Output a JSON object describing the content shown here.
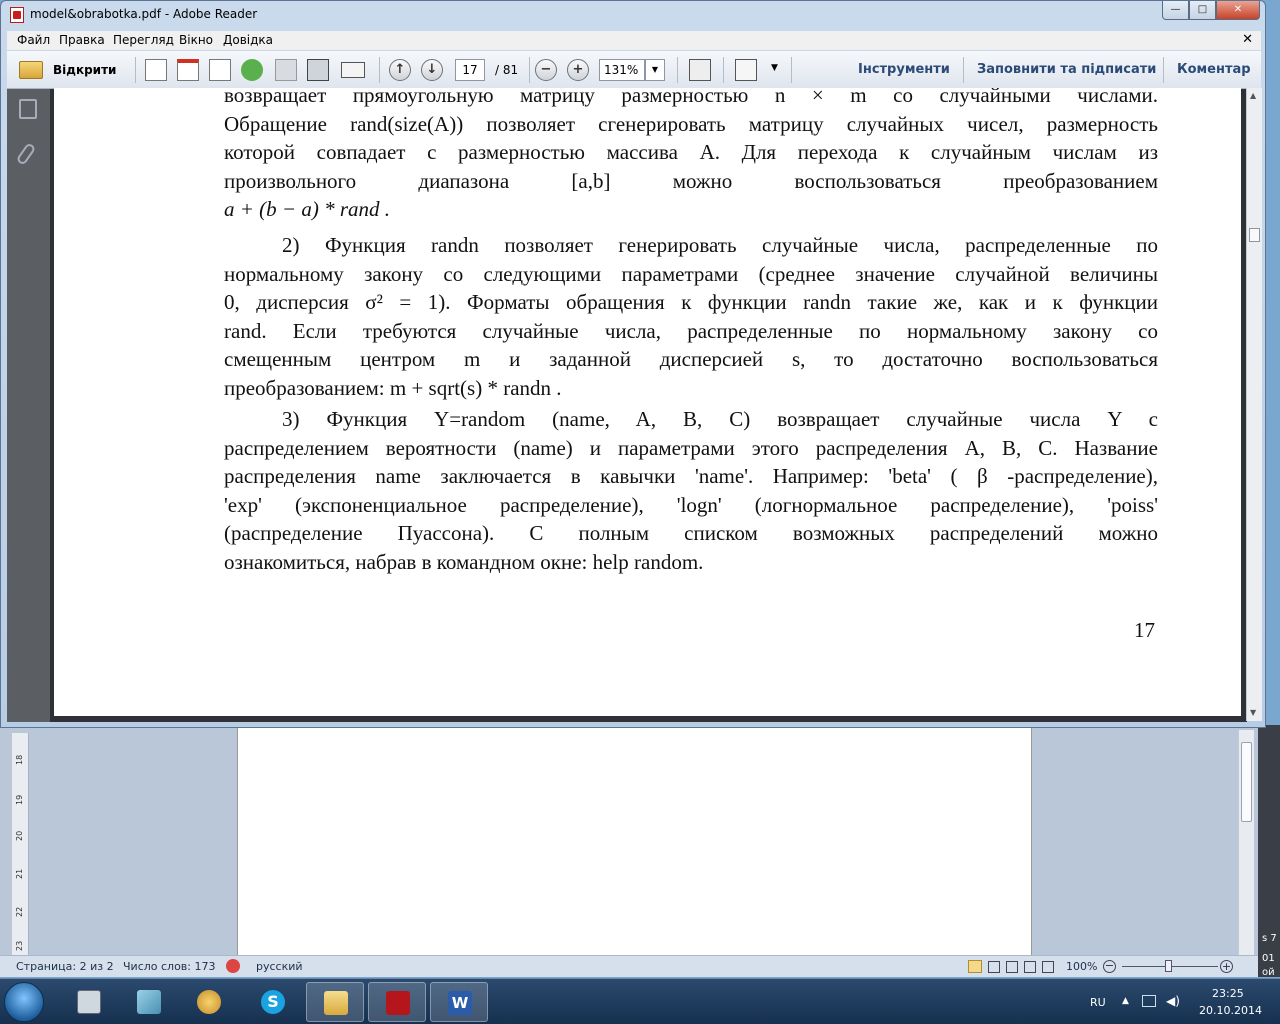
{
  "window": {
    "title": "model&obrabotka.pdf - Adobe Reader",
    "buttons": {
      "minimize": "—",
      "maximize": "□",
      "close": "✕"
    }
  },
  "menu": [
    "Файл",
    "Правка",
    "Перегляд",
    "Вікно",
    "Довідка"
  ],
  "toolbar": {
    "open_label": "Відкрити",
    "page_current": "17",
    "page_total": "/ 81",
    "zoom": "131%",
    "tools_label": "Інструменти",
    "fill_sign_label": "Заповнити та підписати",
    "comment_label": "Коментар"
  },
  "document": {
    "para1": [
      "возвращает прямоугольную матрицу размерностью  n × m  со случайными числами.",
      "Обращение rand(size(A)) позволяет сгенерировать матрицу случайных чисел, размерность",
      "которой совпадает с размерностью массива А. Для перехода к случайным числам из",
      "произвольного диапазона [a,b] можно воспользоваться преобразованием",
      "a + (b − a) * rand ."
    ],
    "para2": [
      "2) Функция randn позволяет генерировать случайные числа, распределенные по",
      "нормальному закону со следующими параметрами (среднее значение случайной величины",
      "0, дисперсия  σ² = 1). Форматы обращения к функции randn такие же, как и к функции",
      "rand. Если требуются случайные числа, распределенные по нормальному закону со",
      "смещенным центром m и заданной дисперсией s, то достаточно воспользоваться",
      "преобразованием:  m + sqrt(s) * randn ."
    ],
    "para3": [
      "3) Функция Y=random (name, A, B, C) возвращает случайные числа Y с",
      "распределением вероятности (name) и параметрами этого распределения A, B, C. Название",
      "распределения name заключается в кавычки 'name'. Например: 'beta' ( β -распределение),",
      "'exp' (экспоненциальное распределение), 'logn' (логнормальное распределение), 'poiss'",
      "(распределение Пуассона). С полным списком возможных распределений можно",
      "ознакомиться, набрав в командном окне: help random."
    ],
    "page_number": "17"
  },
  "word_status": {
    "page": "Страница: 2 из 2",
    "words": "Число слов: 173",
    "language": "русский",
    "zoom": "100%",
    "ruler_marks": [
      "18",
      "19",
      "20",
      "21",
      "22",
      "23"
    ],
    "edge_text": [
      "s 7",
      "01",
      "ой"
    ]
  },
  "taskbar": {
    "lang": "RU",
    "time": "23:25",
    "date": "20.10.2014"
  }
}
